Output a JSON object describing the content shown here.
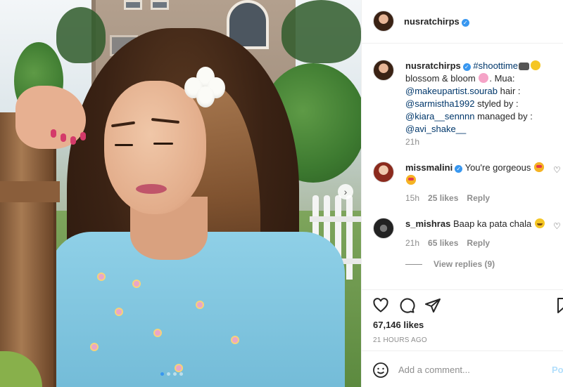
{
  "post": {
    "author": "nusratchirps",
    "caption": {
      "username": "nusratchirps",
      "hashtag": "#shoottime",
      "text1": "blossom & bloom",
      "text2": ". Mua:",
      "mention1": "@makeupartist.sourab",
      "text3": " hair :",
      "mention2": "@sarmistha1992",
      "text4": " styled by :",
      "mention3": "@kiara__sennnn",
      "text5": " managed by :",
      "mention4": "@avi_shake__",
      "time": "21h"
    },
    "comments": [
      {
        "username": "missmalini",
        "text": "You're gorgeous",
        "time": "15h",
        "likes": "25 likes",
        "reply": "Reply"
      },
      {
        "username": "s_mishras",
        "text": "Baap ka pata chala",
        "time": "21h",
        "likes": "65 likes",
        "reply": "Reply"
      }
    ],
    "view_replies": "View replies (9)",
    "likes": "67,146 likes",
    "posted": "21 HOURS AGO",
    "add_comment_placeholder": "Add a comment...",
    "post_label": "Post"
  },
  "accent": "#3897f0",
  "carousel": {
    "slide_count": 4,
    "active_index": 0
  }
}
